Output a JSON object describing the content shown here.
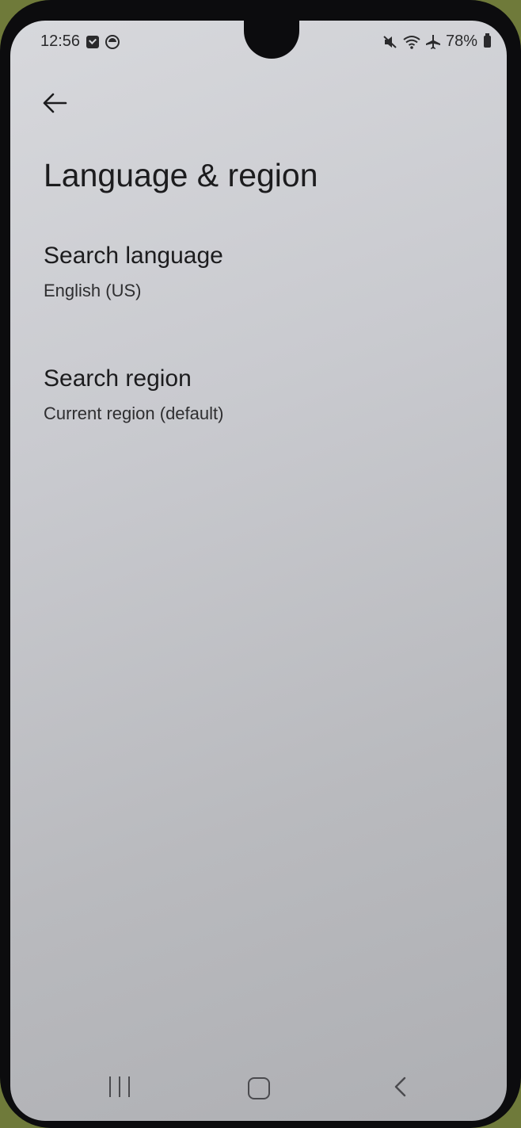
{
  "status_bar": {
    "time": "12:56",
    "notification_icons": [
      "checkbox-icon",
      "circle-icon"
    ],
    "system_icons": [
      "mute-icon",
      "wifi-icon",
      "airplane-icon",
      "battery-icon"
    ],
    "battery": "78%"
  },
  "header": {
    "back_icon": "arrow-left-icon",
    "title": "Language & region"
  },
  "settings": [
    {
      "title": "Search language",
      "value": "English (US)"
    },
    {
      "title": "Search region",
      "value": "Current region (default)"
    }
  ],
  "nav_bar": {
    "buttons": [
      "recents-icon",
      "home-icon",
      "back-icon"
    ]
  }
}
